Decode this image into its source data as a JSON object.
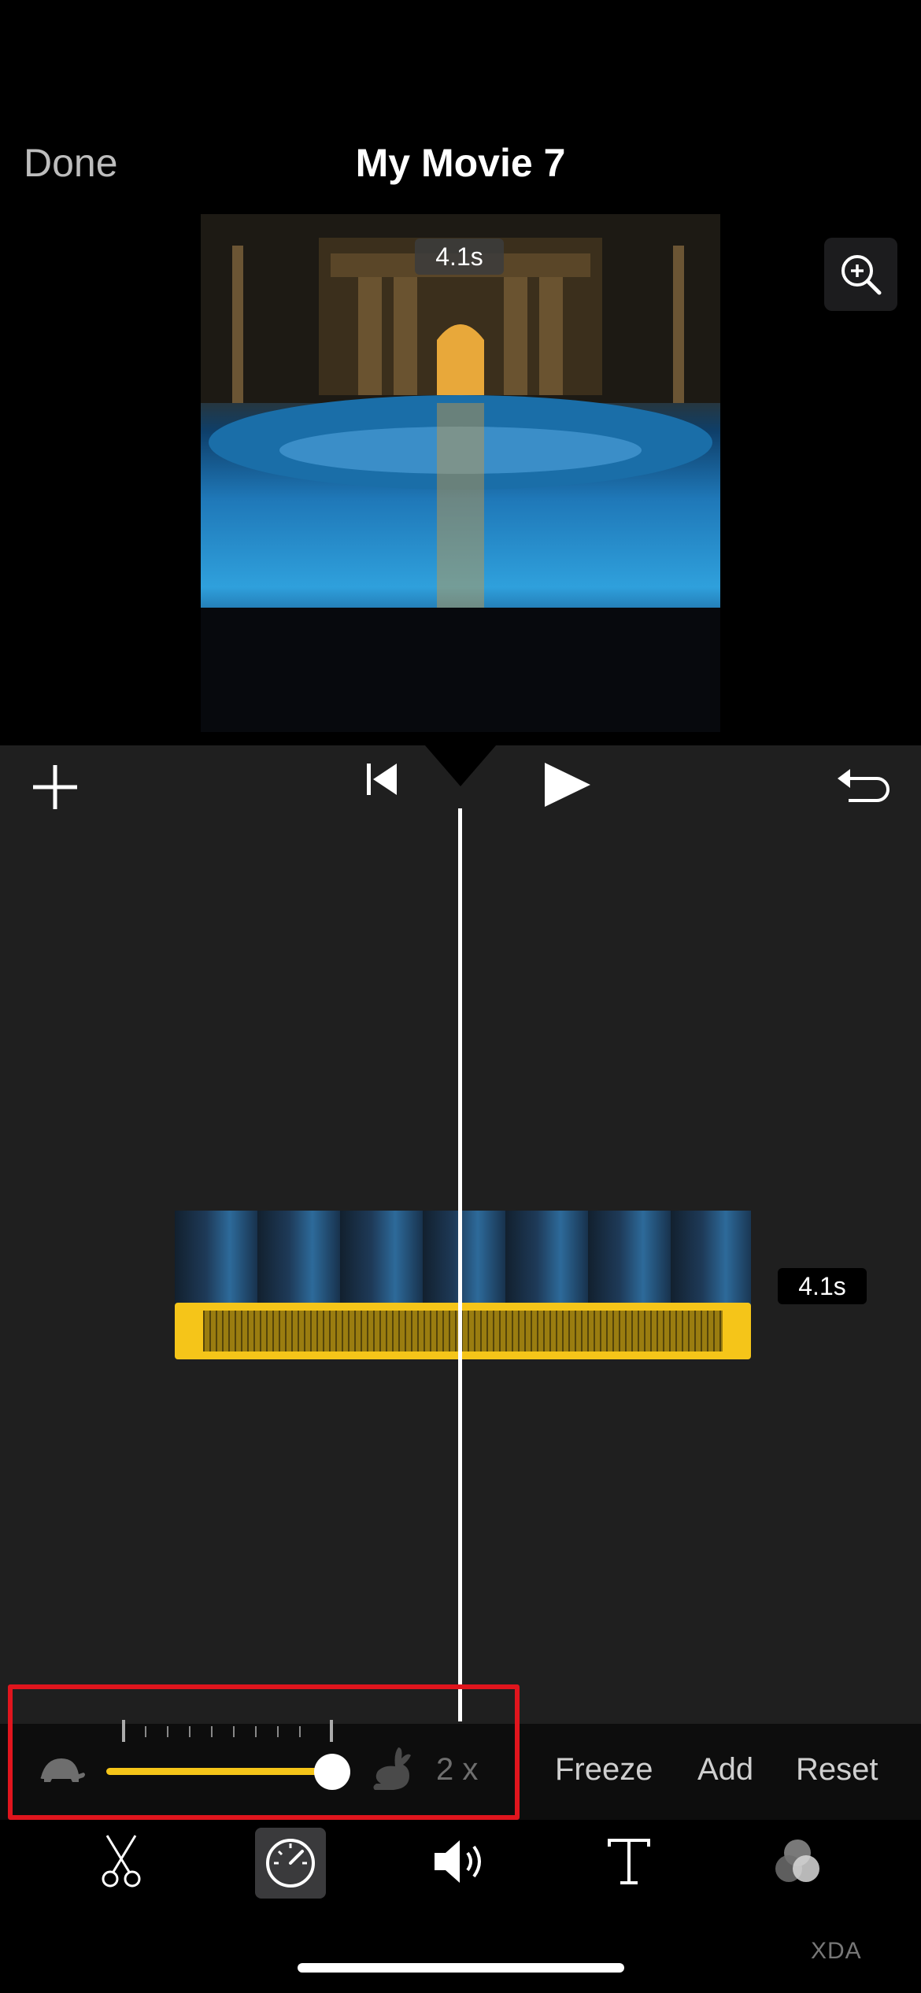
{
  "header": {
    "done_label": "Done",
    "title": "My Movie 7"
  },
  "preview": {
    "duration": "4.1s"
  },
  "timeline": {
    "clip_duration": "4.1s"
  },
  "speed_panel": {
    "speed_value": "2 x",
    "slider_level": 1.0,
    "freeze_label": "Freeze",
    "add_label": "Add",
    "reset_label": "Reset"
  },
  "toolbar": {
    "tools": [
      "scissors-icon",
      "speedometer-icon",
      "speaker-icon",
      "text-icon",
      "filters-icon"
    ]
  },
  "watermark": {
    "text": "XDA"
  },
  "colors": {
    "accent": "#f5c519",
    "highlight": "#e0151d",
    "panel": "#1f1f1f"
  }
}
